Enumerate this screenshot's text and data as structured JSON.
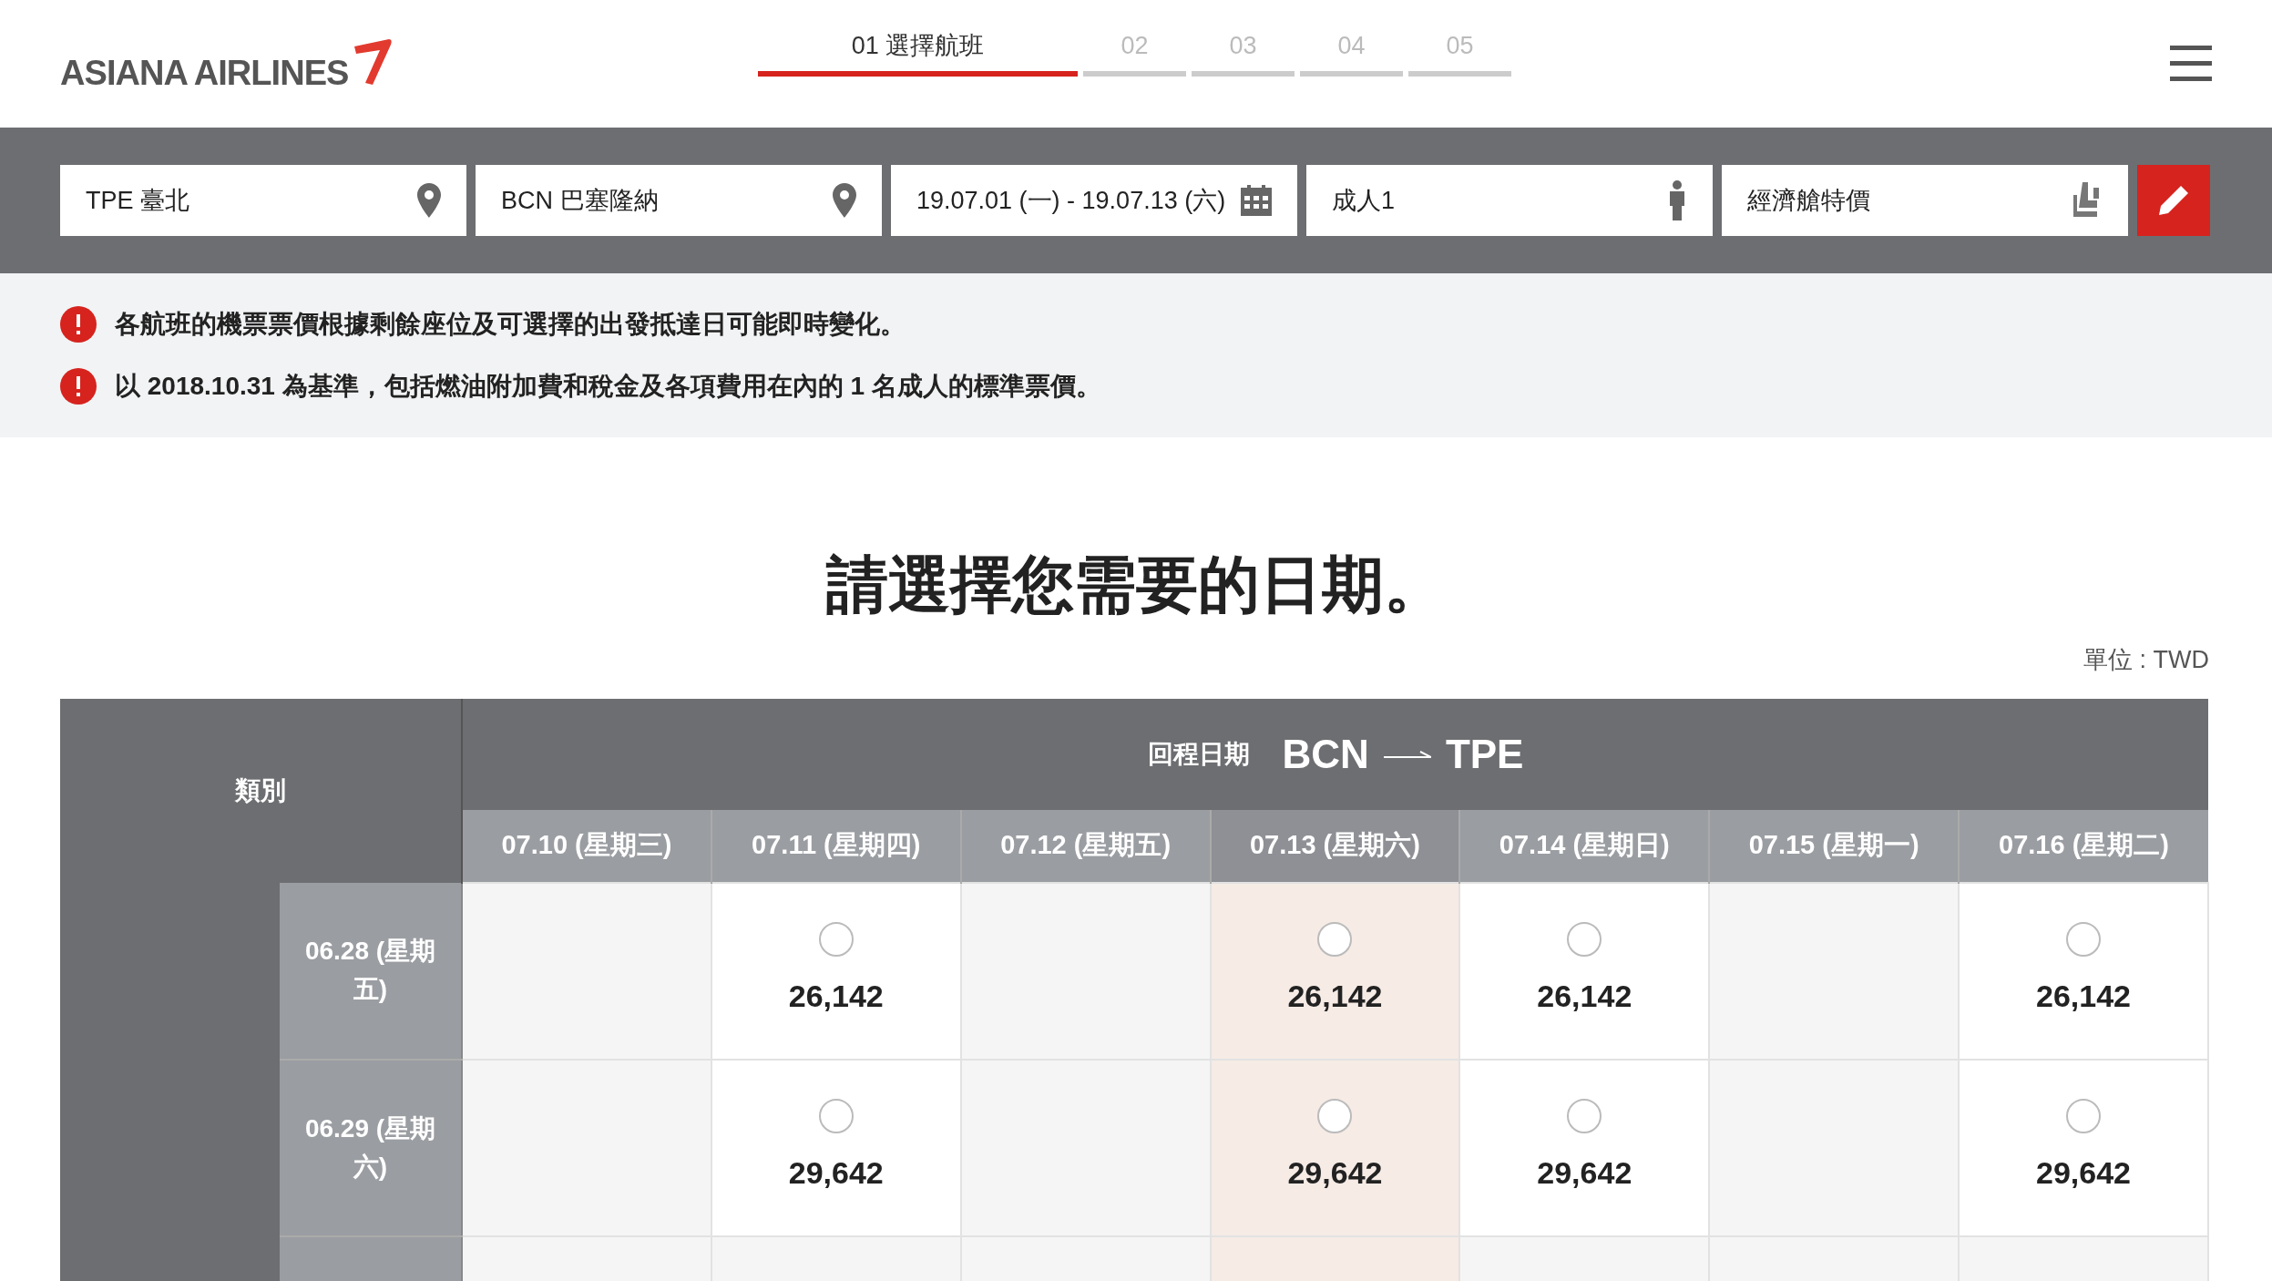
{
  "header": {
    "logo": "ASIANA AIRLINES",
    "steps": [
      {
        "label": "01 選擇航班",
        "selected": true
      },
      {
        "label": "02",
        "selected": false
      },
      {
        "label": "03",
        "selected": false
      },
      {
        "label": "04",
        "selected": false
      },
      {
        "label": "05",
        "selected": false
      }
    ]
  },
  "search": {
    "fields": [
      {
        "kind": "location",
        "value": "TPE 臺北"
      },
      {
        "kind": "location",
        "value": "BCN 巴塞隆納"
      },
      {
        "kind": "date",
        "value": "19.07.01 (一) - 19.07.13 (六)"
      },
      {
        "kind": "passenger",
        "value": "成人1"
      },
      {
        "kind": "cabin",
        "value": "經濟艙特價"
      }
    ]
  },
  "notices": [
    "各航班的機票票價根據剩餘座位及可選擇的出發抵達日可能即時變化。",
    "以 2018.10.31 為基準，包括燃油附加費和稅金及各項費用在內的 1 名成人的標準票價。"
  ],
  "title": "請選擇您需要的日期。",
  "unit": "單位 : TWD",
  "table": {
    "category_header": "類別",
    "return_label": "回程日期",
    "route_from": "BCN",
    "route_to": "TPE",
    "columns": [
      {
        "label": "07.10 (星期三)",
        "selected": false
      },
      {
        "label": "07.11 (星期四)",
        "selected": false
      },
      {
        "label": "07.12 (星期五)",
        "selected": false
      },
      {
        "label": "07.13 (星期六)",
        "selected": true
      },
      {
        "label": "07.14 (星期日)",
        "selected": false
      },
      {
        "label": "07.15 (星期一)",
        "selected": false
      },
      {
        "label": "07.16 (星期二)",
        "selected": false
      }
    ],
    "rows": [
      {
        "label": "06.28 (星期五)",
        "cells": [
          {
            "available": false
          },
          {
            "available": true,
            "checked": false,
            "price": "26,142"
          },
          {
            "available": false
          },
          {
            "available": true,
            "checked": false,
            "price": "26,142"
          },
          {
            "available": true,
            "checked": false,
            "price": "26,142"
          },
          {
            "available": false
          },
          {
            "available": true,
            "checked": false,
            "price": "26,142"
          }
        ]
      },
      {
        "label": "06.29 (星期六)",
        "cells": [
          {
            "available": false
          },
          {
            "available": true,
            "checked": false,
            "price": "29,642"
          },
          {
            "available": false
          },
          {
            "available": true,
            "checked": false,
            "price": "29,642"
          },
          {
            "available": true,
            "checked": false,
            "price": "29,642"
          },
          {
            "available": false
          },
          {
            "available": true,
            "checked": false,
            "price": "29,642"
          }
        ]
      },
      {
        "cells": [
          {
            "available": false
          },
          {
            "available": false
          },
          {
            "available": false
          },
          {
            "available": false
          },
          {
            "available": false
          },
          {
            "available": false
          },
          {
            "available": false
          }
        ]
      }
    ]
  }
}
